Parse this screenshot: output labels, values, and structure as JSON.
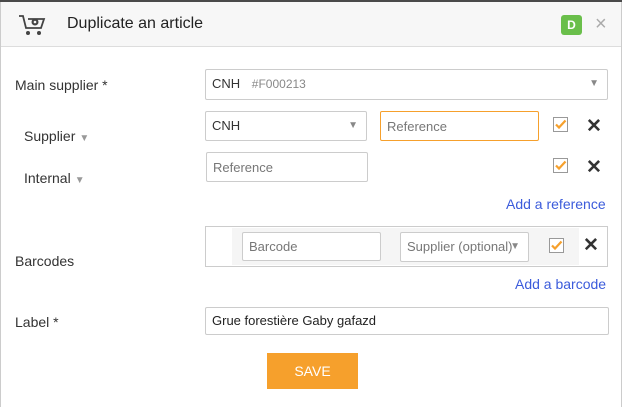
{
  "header": {
    "title": "Duplicate an article",
    "badge": "D",
    "close_symbol": "×"
  },
  "main_supplier": {
    "label": "Main supplier *",
    "value": "CNH",
    "code": "#F000213"
  },
  "references": [
    {
      "label": "Supplier",
      "select_value": "CNH",
      "input_placeholder": "Reference",
      "checked": true
    },
    {
      "label": "Internal",
      "input_placeholder": "Reference",
      "checked": true
    }
  ],
  "add_reference_label": "Add a reference",
  "barcodes": {
    "label": "Barcodes",
    "barcode_placeholder": "Barcode",
    "supplier_select": "Supplier (optional)",
    "checked": true,
    "add_label": "Add a barcode"
  },
  "label_field": {
    "label": "Label *",
    "value": "Grue forestière Gaby gafazd"
  },
  "save_label": "SAVE",
  "colors": {
    "accent": "#f6a02c",
    "link": "#3b5bdb",
    "badge": "#6abf4b"
  }
}
